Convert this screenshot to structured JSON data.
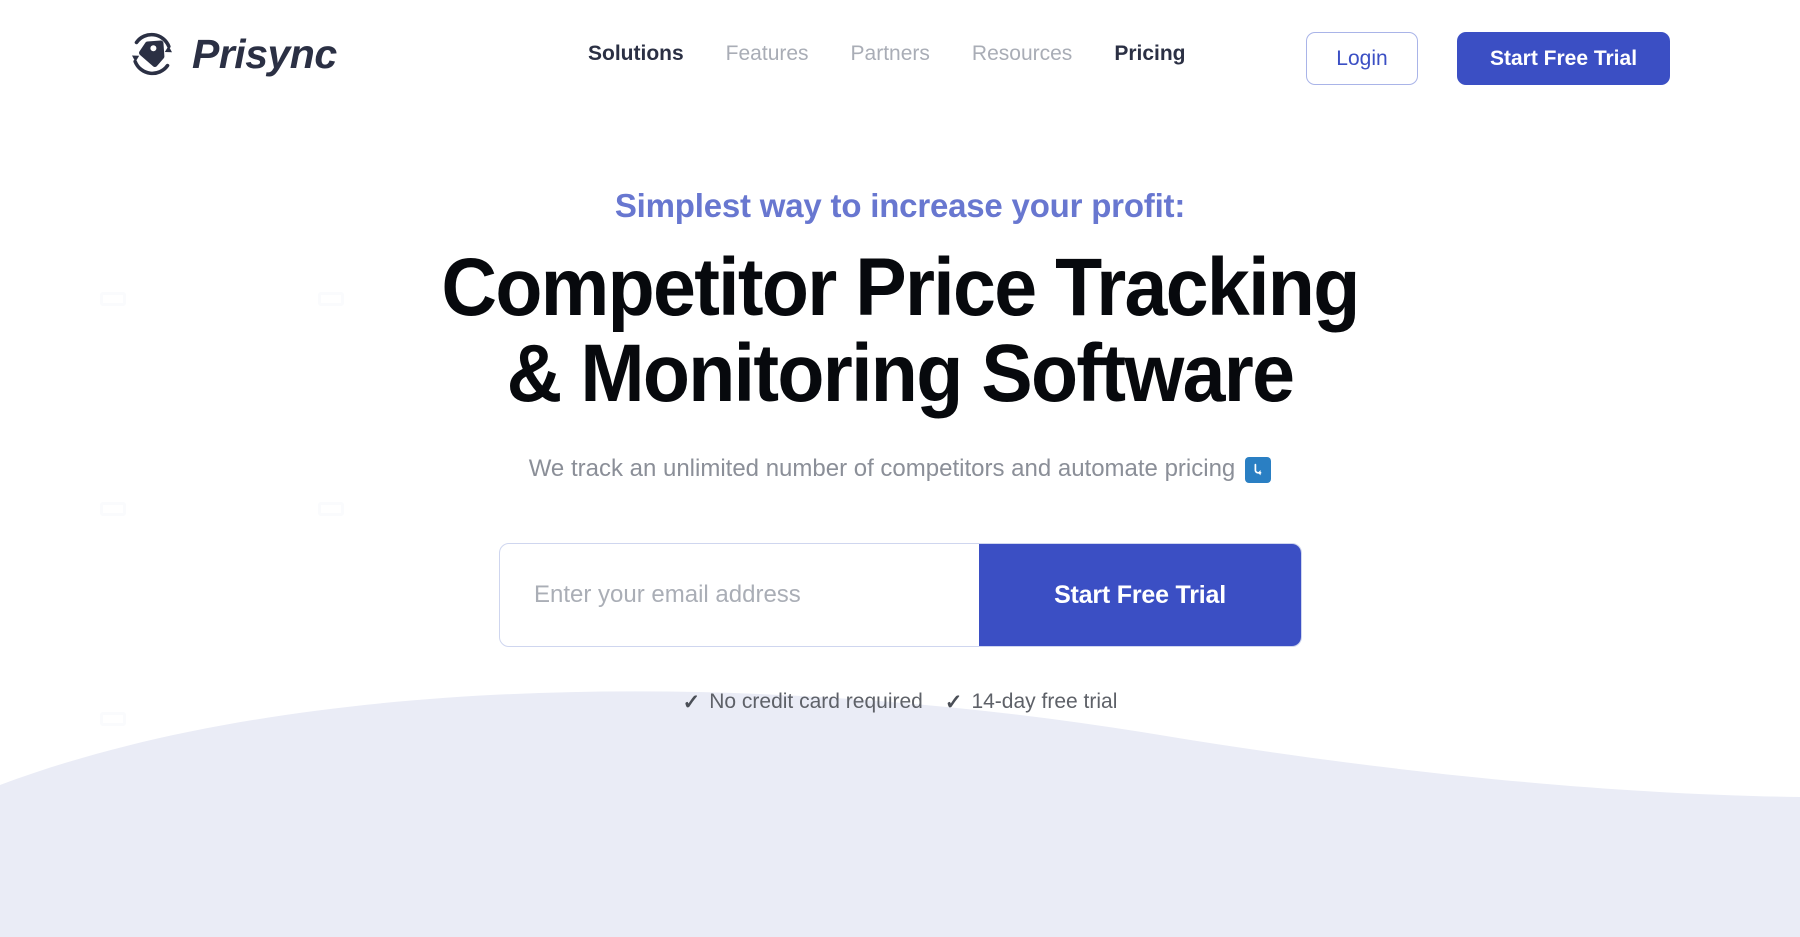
{
  "header": {
    "brand": {
      "name": "Prisync",
      "logo_icon": "price-tag-sync-icon"
    },
    "nav": [
      {
        "label": "Solutions",
        "active": true
      },
      {
        "label": "Features",
        "active": false
      },
      {
        "label": "Partners",
        "active": false
      },
      {
        "label": "Resources",
        "active": false
      },
      {
        "label": "Pricing",
        "active": true
      }
    ],
    "login_label": "Login",
    "trial_label": "Start Free Trial"
  },
  "hero": {
    "eyebrow": "Simplest way to increase your profit:",
    "title_line1": "Competitor Price Tracking",
    "title_line2": "& Monitoring Software",
    "subtitle": "We track an unlimited number of competitors and automate pricing",
    "subtitle_icon": "curved-down-arrow-icon"
  },
  "signup": {
    "email_placeholder": "Enter your email address",
    "email_value": "",
    "submit_label": "Start Free Trial"
  },
  "trust": [
    {
      "icon": "check-icon",
      "label": "No credit card required"
    },
    {
      "icon": "check-icon",
      "label": "14-day free trial"
    }
  ],
  "colors": {
    "brand_blue": "#3b4fc4",
    "eyebrow_blue": "#6877d0",
    "logo_navy": "#2b3044",
    "muted_gray": "#a9adb6",
    "wave_lavender": "#eaecf6",
    "sub_icon_blue": "#2a7fc3"
  }
}
